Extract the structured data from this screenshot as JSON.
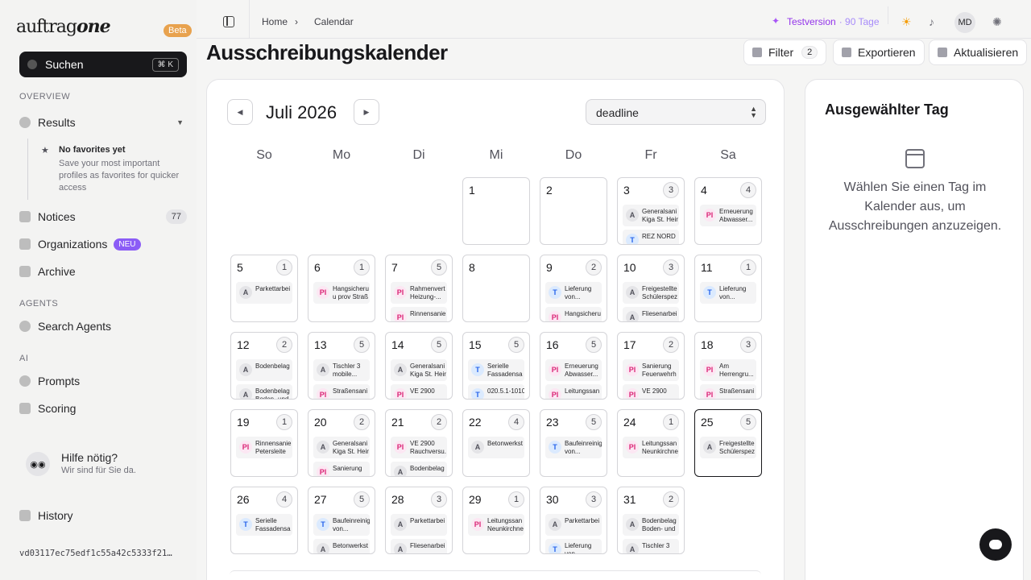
{
  "brand": {
    "logo_left": "auftrag",
    "logo_right": "one",
    "beta": "Beta"
  },
  "search": {
    "label": "Suchen",
    "shortcut": "⌘ K"
  },
  "sections": {
    "overview": "OVERVIEW",
    "agents": "AGENTS",
    "ai": "AI"
  },
  "nav": {
    "results": "Results",
    "favorites_title": "No favorites yet",
    "favorites_text": "Save your most important profiles as favorites for quicker access",
    "notices": "Notices",
    "notices_count": "77",
    "organizations": "Organizations",
    "organizations_badge": "NEU",
    "archive": "Archive",
    "search_agents": "Search Agents",
    "prompts": "Prompts",
    "scoring": "Scoring",
    "history": "History"
  },
  "help": {
    "title": "Hilfe nötig?",
    "subtitle": "Wir sind für Sie da."
  },
  "build_hash": "vd03117ec75edf1c55a42c5333f21…",
  "breadcrumb": {
    "home": "Home",
    "current": "Calendar"
  },
  "topbar": {
    "trial_label": "Testversion",
    "trial_days": "· 90 Tage",
    "avatar": "MD"
  },
  "page": {
    "title": "Ausschreibungskalender"
  },
  "toolbar": {
    "filter": "Filter",
    "filter_count": "2",
    "export": "Exportieren",
    "refresh": "Aktualisieren"
  },
  "calendar": {
    "month": "Juli 2026",
    "date_field": "deadline",
    "weekdays": [
      "So",
      "Mo",
      "Di",
      "Mi",
      "Do",
      "Fr",
      "Sa"
    ],
    "selected_day": 25,
    "days": [
      {
        "day": "1",
        "col": 3,
        "row": 0,
        "events": []
      },
      {
        "day": "2",
        "col": 4,
        "row": 0,
        "events": []
      },
      {
        "day": "3",
        "col": 5,
        "row": 0,
        "count": "3",
        "events": [
          {
            "type": "A",
            "text": "Generalsani\nKiga St. Heir"
          },
          {
            "type": "T",
            "text": "REZ NORD"
          }
        ]
      },
      {
        "day": "4",
        "col": 6,
        "row": 0,
        "count": "4",
        "events": [
          {
            "type": "PI",
            "text": "Erneuerung\nAbwasser..."
          }
        ]
      },
      {
        "day": "5",
        "col": 0,
        "row": 1,
        "count": "1",
        "events": [
          {
            "type": "A",
            "text": "Parkettarbei"
          }
        ]
      },
      {
        "day": "6",
        "col": 1,
        "row": 1,
        "count": "1",
        "events": [
          {
            "type": "PI",
            "text": "Hangsicheru\nu prov Straß"
          }
        ]
      },
      {
        "day": "7",
        "col": 2,
        "row": 1,
        "count": "5",
        "events": [
          {
            "type": "PI",
            "text": "Rahmenvert\nHeizung-..."
          },
          {
            "type": "PI",
            "text": "Rinnensanie"
          }
        ]
      },
      {
        "day": "8",
        "col": 3,
        "row": 1,
        "events": []
      },
      {
        "day": "9",
        "col": 4,
        "row": 1,
        "count": "2",
        "events": [
          {
            "type": "T",
            "text": "Lieferung\nvon..."
          },
          {
            "type": "PI",
            "text": "Hangsicheru"
          }
        ]
      },
      {
        "day": "10",
        "col": 5,
        "row": 1,
        "count": "3",
        "events": [
          {
            "type": "A",
            "text": "Freigestellte\nSchülerspez"
          },
          {
            "type": "A",
            "text": "Fliesenarbei"
          }
        ]
      },
      {
        "day": "11",
        "col": 6,
        "row": 1,
        "count": "1",
        "events": [
          {
            "type": "T",
            "text": "Lieferung\nvon..."
          }
        ]
      },
      {
        "day": "12",
        "col": 0,
        "row": 2,
        "count": "2",
        "events": [
          {
            "type": "A",
            "text": "Bodenbelag"
          },
          {
            "type": "A",
            "text": "Bodenbelag\nBoden- und"
          }
        ]
      },
      {
        "day": "13",
        "col": 1,
        "row": 2,
        "count": "5",
        "events": [
          {
            "type": "A",
            "text": "Tischler 3\nmobile..."
          },
          {
            "type": "PI",
            "text": "Straßensani"
          }
        ]
      },
      {
        "day": "14",
        "col": 2,
        "row": 2,
        "count": "5",
        "events": [
          {
            "type": "A",
            "text": "Generalsani\nKiga St. Heir"
          },
          {
            "type": "PI",
            "text": "VE 2900"
          }
        ]
      },
      {
        "day": "15",
        "col": 3,
        "row": 2,
        "count": "5",
        "events": [
          {
            "type": "T",
            "text": "Serielle\nFassadensa"
          },
          {
            "type": "T",
            "text": "020.5.1-1010"
          }
        ]
      },
      {
        "day": "16",
        "col": 4,
        "row": 2,
        "count": "5",
        "events": [
          {
            "type": "PI",
            "text": "Erneuerung\nAbwasser..."
          },
          {
            "type": "PI",
            "text": "Leitungssan"
          }
        ]
      },
      {
        "day": "17",
        "col": 5,
        "row": 2,
        "count": "2",
        "events": [
          {
            "type": "PI",
            "text": "Sanierung\nFeuerwehrh"
          },
          {
            "type": "PI",
            "text": "VE 2900"
          }
        ]
      },
      {
        "day": "18",
        "col": 6,
        "row": 2,
        "count": "3",
        "events": [
          {
            "type": "PI",
            "text": "Am\nHerrengru..."
          },
          {
            "type": "PI",
            "text": "Straßensani"
          }
        ]
      },
      {
        "day": "19",
        "col": 0,
        "row": 3,
        "count": "1",
        "events": [
          {
            "type": "PI",
            "text": "Rinnensanie\nPetersleite"
          }
        ]
      },
      {
        "day": "20",
        "col": 1,
        "row": 3,
        "count": "2",
        "events": [
          {
            "type": "A",
            "text": "Generalsani\nKiga St. Heir"
          },
          {
            "type": "PI",
            "text": "Sanierung"
          }
        ]
      },
      {
        "day": "21",
        "col": 2,
        "row": 3,
        "count": "2",
        "events": [
          {
            "type": "PI",
            "text": "VE 2900\nRauchversu."
          },
          {
            "type": "A",
            "text": "Bodenbelag"
          }
        ]
      },
      {
        "day": "22",
        "col": 3,
        "row": 3,
        "count": "4",
        "events": [
          {
            "type": "A",
            "text": "Betonwerkst"
          }
        ]
      },
      {
        "day": "23",
        "col": 4,
        "row": 3,
        "count": "5",
        "events": [
          {
            "type": "T",
            "text": "Baufeinreinig\nvon..."
          }
        ]
      },
      {
        "day": "24",
        "col": 5,
        "row": 3,
        "count": "1",
        "events": [
          {
            "type": "PI",
            "text": "Leitungssan\nNeunkirchne"
          }
        ]
      },
      {
        "day": "25",
        "col": 6,
        "row": 3,
        "count": "5",
        "events": [
          {
            "type": "A",
            "text": "Freigestellte\nSchülerspez"
          }
        ]
      },
      {
        "day": "26",
        "col": 0,
        "row": 4,
        "count": "4",
        "events": [
          {
            "type": "T",
            "text": "Serielle\nFassadensa"
          }
        ]
      },
      {
        "day": "27",
        "col": 1,
        "row": 4,
        "count": "5",
        "events": [
          {
            "type": "T",
            "text": "Baufeinreinig\nvon..."
          },
          {
            "type": "A",
            "text": "Betonwerkst"
          }
        ]
      },
      {
        "day": "28",
        "col": 2,
        "row": 4,
        "count": "3",
        "events": [
          {
            "type": "A",
            "text": "Parkettarbei"
          },
          {
            "type": "A",
            "text": "Fliesenarbei"
          }
        ]
      },
      {
        "day": "29",
        "col": 3,
        "row": 4,
        "count": "1",
        "events": [
          {
            "type": "PI",
            "text": "Leitungssan\nNeunkirchne"
          }
        ]
      },
      {
        "day": "30",
        "col": 4,
        "row": 4,
        "count": "3",
        "events": [
          {
            "type": "A",
            "text": "Parkettarbei"
          },
          {
            "type": "T",
            "text": "Lieferung\nvon..."
          }
        ]
      },
      {
        "day": "31",
        "col": 5,
        "row": 4,
        "count": "2",
        "events": [
          {
            "type": "A",
            "text": "Bodenbelag\nBoden- und"
          },
          {
            "type": "A",
            "text": "Tischler 3"
          }
        ]
      }
    ]
  },
  "side_panel": {
    "title": "Ausgewählter Tag",
    "message": "Wählen Sie einen Tag im Kalender aus, um Ausschreibungen anzuzeigen."
  }
}
